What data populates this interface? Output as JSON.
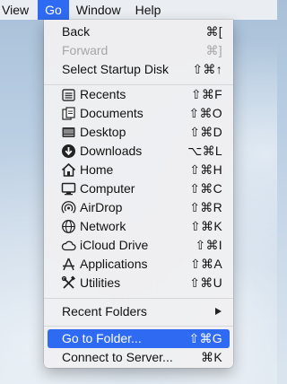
{
  "menubar": {
    "items": [
      "View",
      "Go",
      "Window",
      "Help"
    ]
  },
  "go_menu": {
    "nav": [
      {
        "label": "Back",
        "shortcut": "⌘[",
        "enabled": true
      },
      {
        "label": "Forward",
        "shortcut": "⌘]",
        "enabled": false
      },
      {
        "label": "Select Startup Disk",
        "shortcut": "⇧⌘↑",
        "enabled": true
      }
    ],
    "places": [
      {
        "label": "Recents",
        "shortcut": "⇧⌘F",
        "icon": "recents-icon"
      },
      {
        "label": "Documents",
        "shortcut": "⇧⌘O",
        "icon": "documents-icon"
      },
      {
        "label": "Desktop",
        "shortcut": "⇧⌘D",
        "icon": "desktop-icon"
      },
      {
        "label": "Downloads",
        "shortcut": "⌥⌘L",
        "icon": "downloads-icon"
      },
      {
        "label": "Home",
        "shortcut": "⇧⌘H",
        "icon": "home-icon"
      },
      {
        "label": "Computer",
        "shortcut": "⇧⌘C",
        "icon": "computer-icon"
      },
      {
        "label": "AirDrop",
        "shortcut": "⇧⌘R",
        "icon": "airdrop-icon"
      },
      {
        "label": "Network",
        "shortcut": "⇧⌘K",
        "icon": "network-icon"
      },
      {
        "label": "iCloud Drive",
        "shortcut": "⇧⌘I",
        "icon": "icloud-icon"
      },
      {
        "label": "Applications",
        "shortcut": "⇧⌘A",
        "icon": "applications-icon"
      },
      {
        "label": "Utilities",
        "shortcut": "⇧⌘U",
        "icon": "utilities-icon"
      }
    ],
    "recent_folders": {
      "label": "Recent Folders"
    },
    "go_to_folder": {
      "label": "Go to Folder...",
      "shortcut": "⇧⌘G"
    },
    "connect_to_server": {
      "label": "Connect to Server...",
      "shortcut": "⌘K"
    }
  },
  "colors": {
    "highlight": "#2f6bf2",
    "disabled_text": "#a6a6a6"
  }
}
